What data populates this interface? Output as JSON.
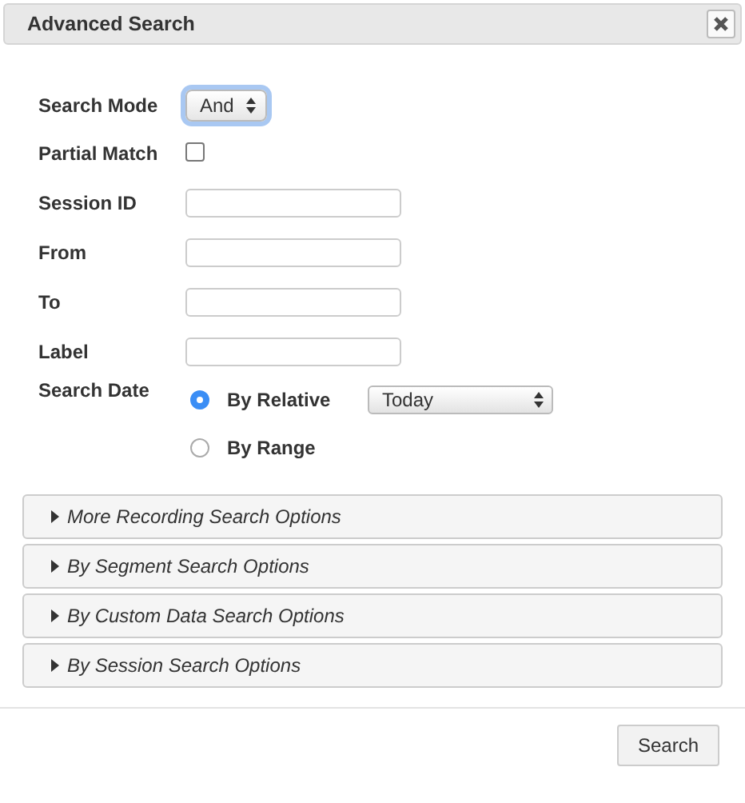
{
  "dialog": {
    "title": "Advanced Search"
  },
  "fields": [
    {
      "kind": "select",
      "label": "Search Mode",
      "value": "And",
      "focused": true
    },
    {
      "kind": "checkbox",
      "label": "Partial Match",
      "checked": false
    },
    {
      "kind": "text",
      "label": "Session ID"
    },
    {
      "kind": "text",
      "label": "From"
    },
    {
      "kind": "text",
      "label": "To"
    },
    {
      "kind": "text",
      "label": "Label"
    },
    {
      "kind": "radios",
      "label": "Search Date",
      "options": [
        {
          "label": "By Relative",
          "selected": true,
          "select_value": "Today"
        },
        {
          "label": "By Range",
          "selected": false
        }
      ]
    }
  ],
  "sections": [
    {
      "title": "More Recording Search Options",
      "expanded": false
    },
    {
      "title": "By Segment Search Options",
      "expanded": false
    },
    {
      "title": "By Custom Data Search Options",
      "expanded": false
    },
    {
      "title": "By Session Search Options",
      "expanded": false
    }
  ],
  "buttons": [
    "Search"
  ]
}
